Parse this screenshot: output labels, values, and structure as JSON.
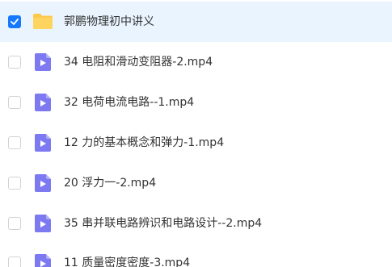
{
  "colors": {
    "accent": "#1677ff",
    "selected_row": "#eaf4fe",
    "folder": "#fdc94b",
    "video": "#7d79f0"
  },
  "files": [
    {
      "name": "郭鹏物理初中讲义",
      "type": "folder",
      "icon": "folder-icon",
      "selected": true
    },
    {
      "name": "34 电阻和滑动变阻器-2.mp4",
      "type": "video",
      "icon": "video-file-icon",
      "selected": false
    },
    {
      "name": "32 电荷电流电路--1.mp4",
      "type": "video",
      "icon": "video-file-icon",
      "selected": false
    },
    {
      "name": "12 力的基本概念和弹力-1.mp4",
      "type": "video",
      "icon": "video-file-icon",
      "selected": false
    },
    {
      "name": "20 浮力一-2.mp4",
      "type": "video",
      "icon": "video-file-icon",
      "selected": false
    },
    {
      "name": "35 串并联电路辨识和电路设计--2.mp4",
      "type": "video",
      "icon": "video-file-icon",
      "selected": false
    },
    {
      "name": "11 质量密度密度-3.mp4",
      "type": "video",
      "icon": "video-file-icon",
      "selected": false
    }
  ]
}
